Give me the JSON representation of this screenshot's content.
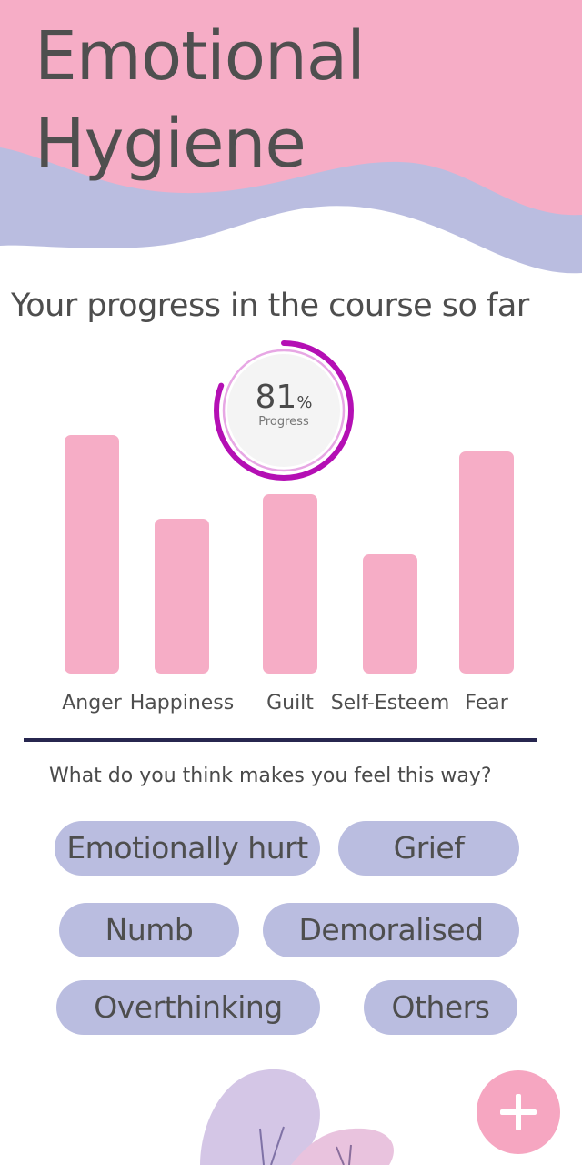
{
  "header": {
    "title_line1": "Emotional",
    "title_line2": "Hygiene"
  },
  "progress_section": {
    "heading": "Your progress in the course so far",
    "progress_value": "81",
    "progress_unit": "%",
    "progress_caption": "Progress",
    "progress_fraction": 0.81
  },
  "colors": {
    "header_pink": "#f6adc6",
    "header_lavender": "#babde0",
    "bar": "#f6adc6",
    "chip": "#babde0",
    "ring": "#b40fb4",
    "divider": "#27264f",
    "fab": "#f6a6c1"
  },
  "chart_data": {
    "type": "bar",
    "categories": [
      "Anger",
      "Happiness",
      "Guilt",
      "Self-Esteem",
      "Fear"
    ],
    "values": [
      100,
      65,
      75,
      50,
      93
    ],
    "title": "",
    "xlabel": "",
    "ylabel": ""
  },
  "feelings": {
    "question": "What do you think makes you feel this way?",
    "options": [
      "Emotionally hurt",
      "Grief",
      "Numb",
      "Demoralised",
      "Overthinking",
      "Others"
    ]
  },
  "fab": {
    "icon": "plus-icon"
  },
  "decor": {
    "icon": "plant-illustration"
  }
}
